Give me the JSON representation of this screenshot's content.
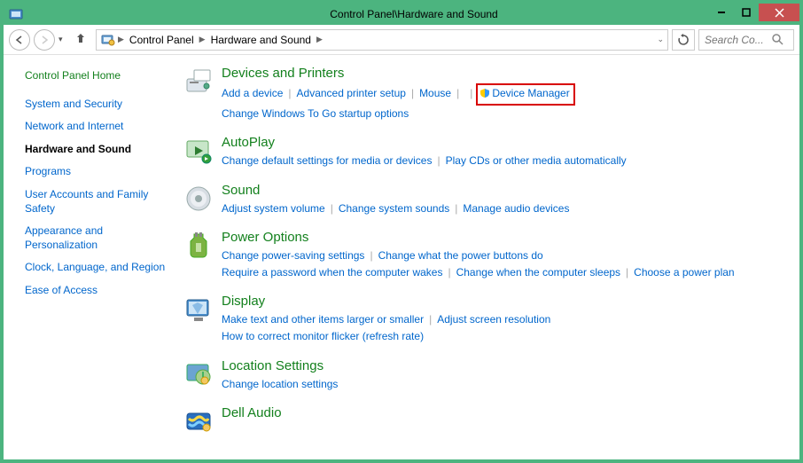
{
  "titlebar": {
    "title": "Control Panel\\Hardware and Sound"
  },
  "breadcrumb": {
    "items": [
      "Control Panel",
      "Hardware and Sound"
    ]
  },
  "search": {
    "placeholder": "Search Co..."
  },
  "sidebar": {
    "home": "Control Panel Home",
    "items": [
      "System and Security",
      "Network and Internet",
      "Hardware and Sound",
      "Programs",
      "User Accounts and Family Safety",
      "Appearance and Personalization",
      "Clock, Language, and Region",
      "Ease of Access"
    ],
    "active_index": 2
  },
  "categories": [
    {
      "title": "Devices and Printers",
      "links": [
        {
          "label": "Add a device"
        },
        {
          "label": "Advanced printer setup"
        },
        {
          "label": "Mouse"
        },
        {
          "label": "Device Manager",
          "shield": true,
          "highlight": true
        },
        {
          "label": "Change Windows To Go startup options",
          "break_before": true
        }
      ]
    },
    {
      "title": "AutoPlay",
      "links": [
        {
          "label": "Change default settings for media or devices"
        },
        {
          "label": "Play CDs or other media automatically"
        }
      ]
    },
    {
      "title": "Sound",
      "links": [
        {
          "label": "Adjust system volume"
        },
        {
          "label": "Change system sounds"
        },
        {
          "label": "Manage audio devices"
        }
      ]
    },
    {
      "title": "Power Options",
      "links": [
        {
          "label": "Change power-saving settings"
        },
        {
          "label": "Change what the power buttons do"
        },
        {
          "label": "Require a password when the computer wakes",
          "break_before": true
        },
        {
          "label": "Change when the computer sleeps"
        },
        {
          "label": "Choose a power plan"
        }
      ]
    },
    {
      "title": "Display",
      "links": [
        {
          "label": "Make text and other items larger or smaller"
        },
        {
          "label": "Adjust screen resolution"
        },
        {
          "label": "How to correct monitor flicker (refresh rate)",
          "break_before": true
        }
      ]
    },
    {
      "title": "Location Settings",
      "links": [
        {
          "label": "Change location settings"
        }
      ]
    },
    {
      "title": "Dell Audio",
      "links": []
    }
  ]
}
